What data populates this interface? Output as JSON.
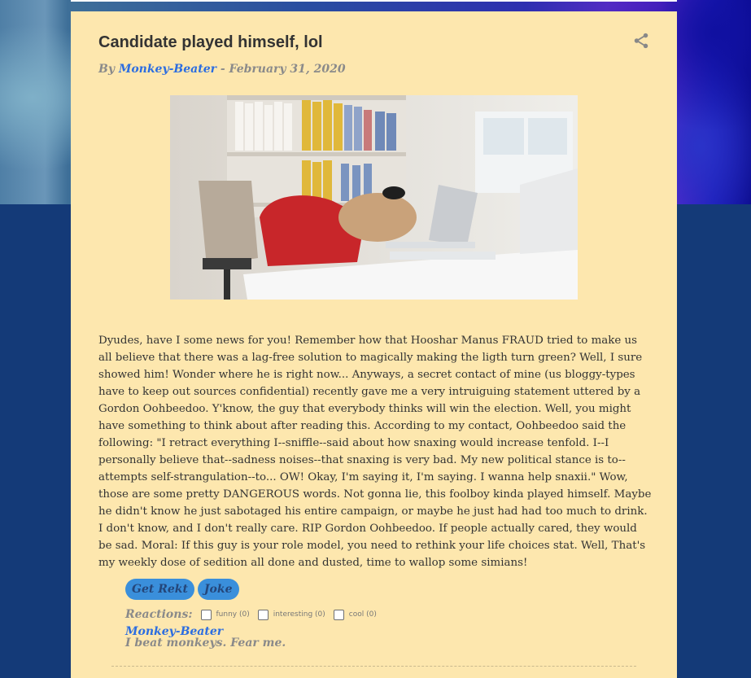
{
  "post": {
    "title": "Candidate played himself, lol",
    "byline_prefix": "By ",
    "author": "Monkey-Beater",
    "date_sep": " - ",
    "date": "February 31, 2020",
    "body": "Dyudes, have I some news for you! Remember how that Hooshar Manus FRAUD tried to make us all believe that there was a lag-free solution to magically making the ligth turn green? Well, I sure showed him! Wonder where he is right now... Anyways, a secret contact of mine (us bloggy-types have to keep out sources confidential) recently gave me a very intruiguing statement uttered by a Gordon Oohbeedoo. Y'know, the guy that everybody thinks will win the election. Well, you might have something to think about after reading this. According to my contact, Oohbeedoo said the following: \"I retract everything I--sniffle--said about how snaxing would increase tenfold. I--I personally believe that--sadness noises--that snaxing is very bad. My new political stance is to--attempts self-strangulation--to... OW! Okay, I'm saying it, I'm saying. I wanna help snaxii.\" Wow, those are some pretty DANGEROUS words. Not gonna lie, this foolboy kinda played himself. Maybe he didn't know he just sabotaged his entire campaign, or maybe he just had had too much to drink. I don't know, and I don't really care. RIP Gordon Oohbeedoo. If people actually cared, they would be sad. Moral: If this guy is your role model, you need to rethink your life choices stat. Well, That's my weekly dose of sedition all done and dusted, time to wallop some simians!"
  },
  "labels": [
    "Get Rekt",
    "Joke"
  ],
  "reactions": {
    "label": "Reactions:",
    "items": [
      {
        "label": "funny (0)"
      },
      {
        "label": "interesting (0)"
      },
      {
        "label": "cool (0)"
      }
    ]
  },
  "profile": {
    "name": "Monkey-Beater",
    "bio": "I beat monkeys. Fear me."
  },
  "icons": {
    "share": "share-icon"
  },
  "colors": {
    "card": "#fde7ae",
    "link": "#2c6de0",
    "label_pill": "#3a8fdb",
    "page_bg": "#143a78"
  }
}
